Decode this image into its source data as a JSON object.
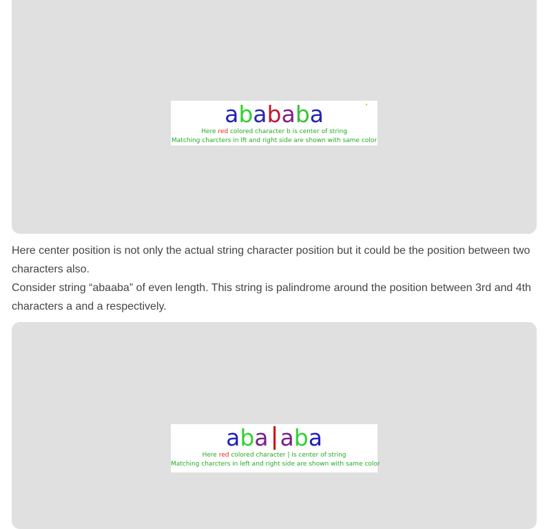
{
  "figure1": {
    "word": [
      "a",
      "b",
      "a",
      "b",
      "a",
      "b",
      "a"
    ],
    "word_colors": [
      "#1f1fbf",
      "#2fd12f",
      "#2626b0",
      "#c0172f",
      "#7a1f8a",
      "#35c235",
      "#2424b5"
    ],
    "caption_line1_pre": "Here ",
    "caption_line1_red": "red",
    "caption_line1_post": " colored character b is center of string",
    "caption_line2": "Matching charcters in lft and right side are shown with same color"
  },
  "text": {
    "p1": "Here center position is not only the actual string character position but it could be the position between two characters also.",
    "p2": "Consider string “abaaba” of even length. This string is palindrome around the position between 3rd and 4th characters a and a respectively."
  },
  "figure2": {
    "left_word": [
      "a",
      "b",
      "a"
    ],
    "left_colors": [
      "#1f1fbf",
      "#2fd12f",
      "#7a1f8a"
    ],
    "right_word": [
      "a",
      "b",
      "a"
    ],
    "right_colors": [
      "#7a1f8a",
      "#2fd12f",
      "#1f1fbf"
    ],
    "caption_line1_pre": "Here ",
    "caption_line1_red": "red",
    "caption_line1_post": " colored character | is center of string",
    "caption_line2": "Matching charcters in left and right side are shown with same color"
  }
}
